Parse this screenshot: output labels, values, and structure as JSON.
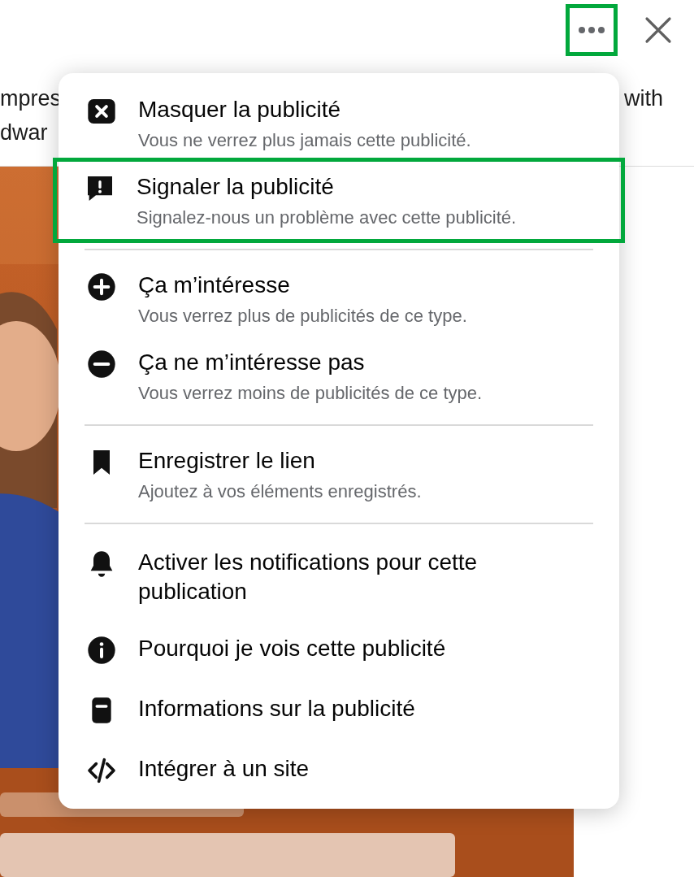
{
  "header": {
    "more_button": {
      "highlighted": true
    }
  },
  "post_text": {
    "left_lines": [
      "mpres",
      "dwar"
    ],
    "right_lines": [
      "with"
    ]
  },
  "menu": {
    "sections": [
      {
        "items": [
          {
            "kind": "hide",
            "title": "Masquer la publicité",
            "subtitle": "Vous ne verrez plus jamais cette publicité.",
            "highlighted": false
          },
          {
            "kind": "report",
            "title": "Signaler la publicité",
            "subtitle": "Signalez-nous un problème avec cette publicité.",
            "highlighted": true
          }
        ]
      },
      {
        "items": [
          {
            "kind": "plus",
            "title": "Ça m’intéresse",
            "subtitle": "Vous verrez plus de publicités de ce type.",
            "highlighted": false
          },
          {
            "kind": "minus",
            "title": "Ça ne m’intéresse pas",
            "subtitle": "Vous verrez moins de publicités de ce type.",
            "highlighted": false
          }
        ]
      },
      {
        "items": [
          {
            "kind": "bookmark",
            "title": "Enregistrer le lien",
            "subtitle": "Ajoutez à vos éléments enregistrés.",
            "highlighted": false
          }
        ]
      },
      {
        "items": [
          {
            "kind": "bell",
            "title": "Activer les notifications pour cette publication",
            "highlighted": false
          },
          {
            "kind": "info",
            "title": "Pourquoi je vois cette publicité",
            "highlighted": false
          },
          {
            "kind": "document",
            "title": "Informations sur la publicité",
            "highlighted": false
          },
          {
            "kind": "code",
            "title": "Intégrer à un site",
            "highlighted": false
          }
        ]
      }
    ]
  }
}
